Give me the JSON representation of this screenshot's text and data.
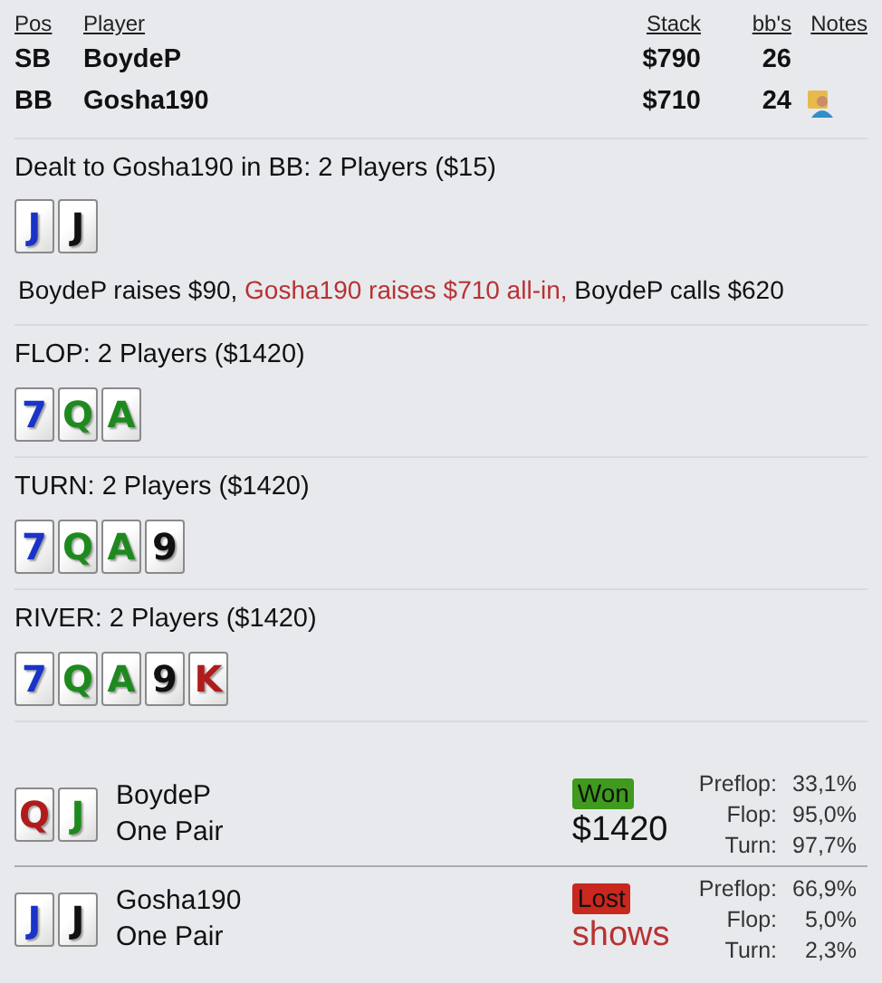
{
  "players_table": {
    "columns": [
      "Pos",
      "Player",
      "Stack",
      "bb's",
      "Notes"
    ],
    "rows": [
      {
        "pos": "SB",
        "player": "BoydeP",
        "stack": "$790",
        "bbs": "26",
        "has_note": false
      },
      {
        "pos": "BB",
        "player": "Gosha190",
        "stack": "$710",
        "bbs": "24",
        "has_note": true
      }
    ]
  },
  "preflop": {
    "title": "Dealt to Gosha190 in BB: 2 Players ($15)",
    "cards": [
      {
        "rank": "J",
        "color": "#1a33c8"
      },
      {
        "rank": "J",
        "color": "#111111"
      }
    ],
    "actions": [
      {
        "text": "BoydeP raises $90,",
        "highlight": false
      },
      {
        "text": "Gosha190 raises $710 all-in,",
        "highlight": true
      },
      {
        "text": "BoydeP calls $620",
        "highlight": false
      }
    ]
  },
  "streets": [
    {
      "title": "FLOP: 2 Players ($1420)",
      "cards": [
        {
          "rank": "7",
          "color": "#1a33c8"
        },
        {
          "rank": "Q",
          "color": "#1e8a1e"
        },
        {
          "rank": "A",
          "color": "#1e8a1e"
        }
      ]
    },
    {
      "title": "TURN: 2 Players ($1420)",
      "cards": [
        {
          "rank": "7",
          "color": "#1a33c8"
        },
        {
          "rank": "Q",
          "color": "#1e8a1e"
        },
        {
          "rank": "A",
          "color": "#1e8a1e"
        },
        {
          "rank": "9",
          "color": "#111111"
        }
      ]
    },
    {
      "title": "RIVER: 2 Players ($1420)",
      "cards": [
        {
          "rank": "7",
          "color": "#1a33c8"
        },
        {
          "rank": "Q",
          "color": "#1e8a1e"
        },
        {
          "rank": "A",
          "color": "#1e8a1e"
        },
        {
          "rank": "9",
          "color": "#111111"
        },
        {
          "rank": "K",
          "color": "#b01c1c"
        }
      ]
    }
  ],
  "showdown": [
    {
      "cards": [
        {
          "rank": "Q",
          "color": "#b01c1c"
        },
        {
          "rank": "J",
          "color": "#1e8a1e"
        }
      ],
      "player": "BoydeP",
      "hand": "One Pair",
      "result": "Won",
      "kind": "won",
      "amount": "$1420",
      "equity": [
        {
          "label": "Preflop:",
          "value": "33,1%"
        },
        {
          "label": "Flop:",
          "value": "95,0%"
        },
        {
          "label": "Turn:",
          "value": "97,7%"
        }
      ]
    },
    {
      "cards": [
        {
          "rank": "J",
          "color": "#1a33c8"
        },
        {
          "rank": "J",
          "color": "#111111"
        }
      ],
      "player": "Gosha190",
      "hand": "One Pair",
      "result": "Lost",
      "kind": "lost",
      "amount": "shows",
      "equity": [
        {
          "label": "Preflop:",
          "value": "66,9%"
        },
        {
          "label": "Flop:",
          "value": "5,0%"
        },
        {
          "label": "Turn:",
          "value": "2,3%"
        }
      ]
    }
  ]
}
